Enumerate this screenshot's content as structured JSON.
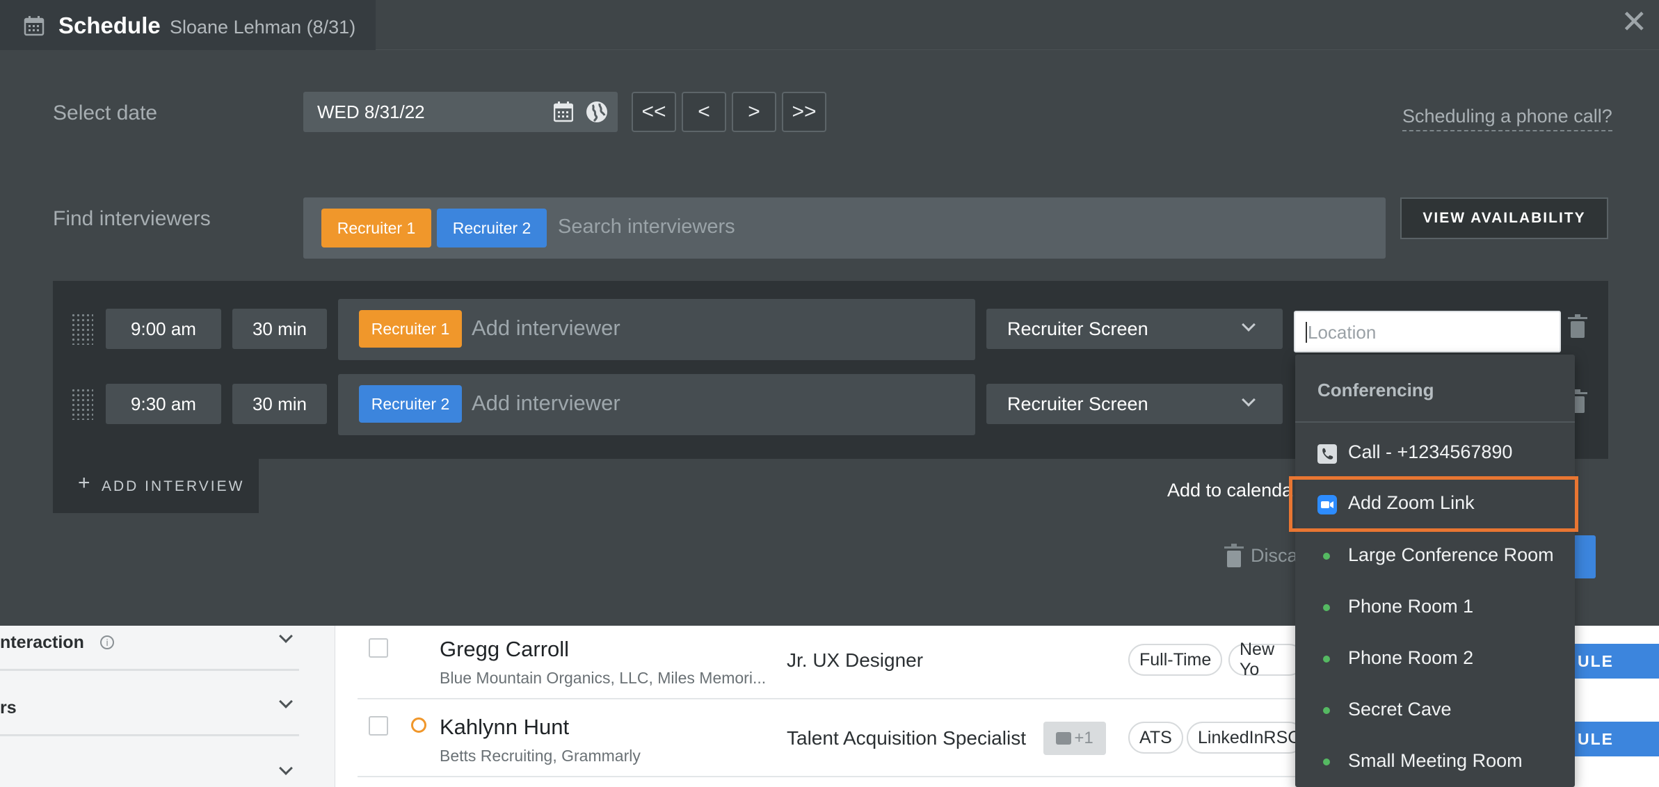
{
  "header": {
    "title": "Schedule",
    "subtitle": "Sloane Lehman (8/31)",
    "close_glyph": "✕"
  },
  "date": {
    "label": "Select date",
    "value": "WED 8/31/22",
    "nav": [
      "<<",
      "<",
      ">",
      ">>"
    ],
    "phone_link": "Scheduling a phone call?"
  },
  "interviewers": {
    "label": "Find interviewers",
    "chips": [
      "Recruiter 1",
      "Recruiter 2"
    ],
    "placeholder": "Search interviewers",
    "view_button": "VIEW AVAILABILITY"
  },
  "interviews": [
    {
      "time": "9:00 am",
      "duration": "30 min",
      "interviewer": "Recruiter 1",
      "placeholder": "Add interviewer",
      "type": "Recruiter Screen"
    },
    {
      "time": "9:30 am",
      "duration": "30 min",
      "interviewer": "Recruiter 2",
      "placeholder": "Add interviewer",
      "type": "Recruiter Screen"
    }
  ],
  "add_interview": "ADD INTERVIEW",
  "add_calendar": "Add to calenda",
  "discard": "Disca",
  "location": {
    "placeholder": "Location",
    "dropdown": {
      "heading": "Conferencing",
      "items": [
        {
          "label": "Call - +1234567890",
          "icon": "phone-icon"
        },
        {
          "label": "Add Zoom Link",
          "icon": "zoom-icon",
          "highlighted": true
        },
        {
          "label": "Large Conference Room",
          "icon": "green-dot"
        },
        {
          "label": "Phone Room 1",
          "icon": "green-dot"
        },
        {
          "label": "Phone Room 2",
          "icon": "green-dot"
        },
        {
          "label": "Secret Cave",
          "icon": "green-dot"
        },
        {
          "label": "Small Meeting Room",
          "icon": "green-dot"
        }
      ]
    }
  },
  "background_list": {
    "sidebar": [
      "nteraction",
      "rs",
      ""
    ],
    "candidates": [
      {
        "name": "Gregg Carroll",
        "sub": "Blue Mountain Organics, LLC, Miles Memori...",
        "role": "Jr. UX Designer",
        "tags": [
          "Full-Time",
          "New Yo"
        ],
        "button": "ULE"
      },
      {
        "name": "Kahlynn Hunt",
        "sub": "Betts Recruiting, Grammarly",
        "role": "Talent Acquisition Specialist",
        "badge": "+1",
        "tags": [
          "ATS",
          "LinkedInRSC"
        ],
        "button": "ULE"
      }
    ]
  },
  "colors": {
    "orange": "#f0972b",
    "blue": "#3c85dd",
    "highlight": "#e97632",
    "zoom": "#2d8cff",
    "available": "#55b962"
  }
}
